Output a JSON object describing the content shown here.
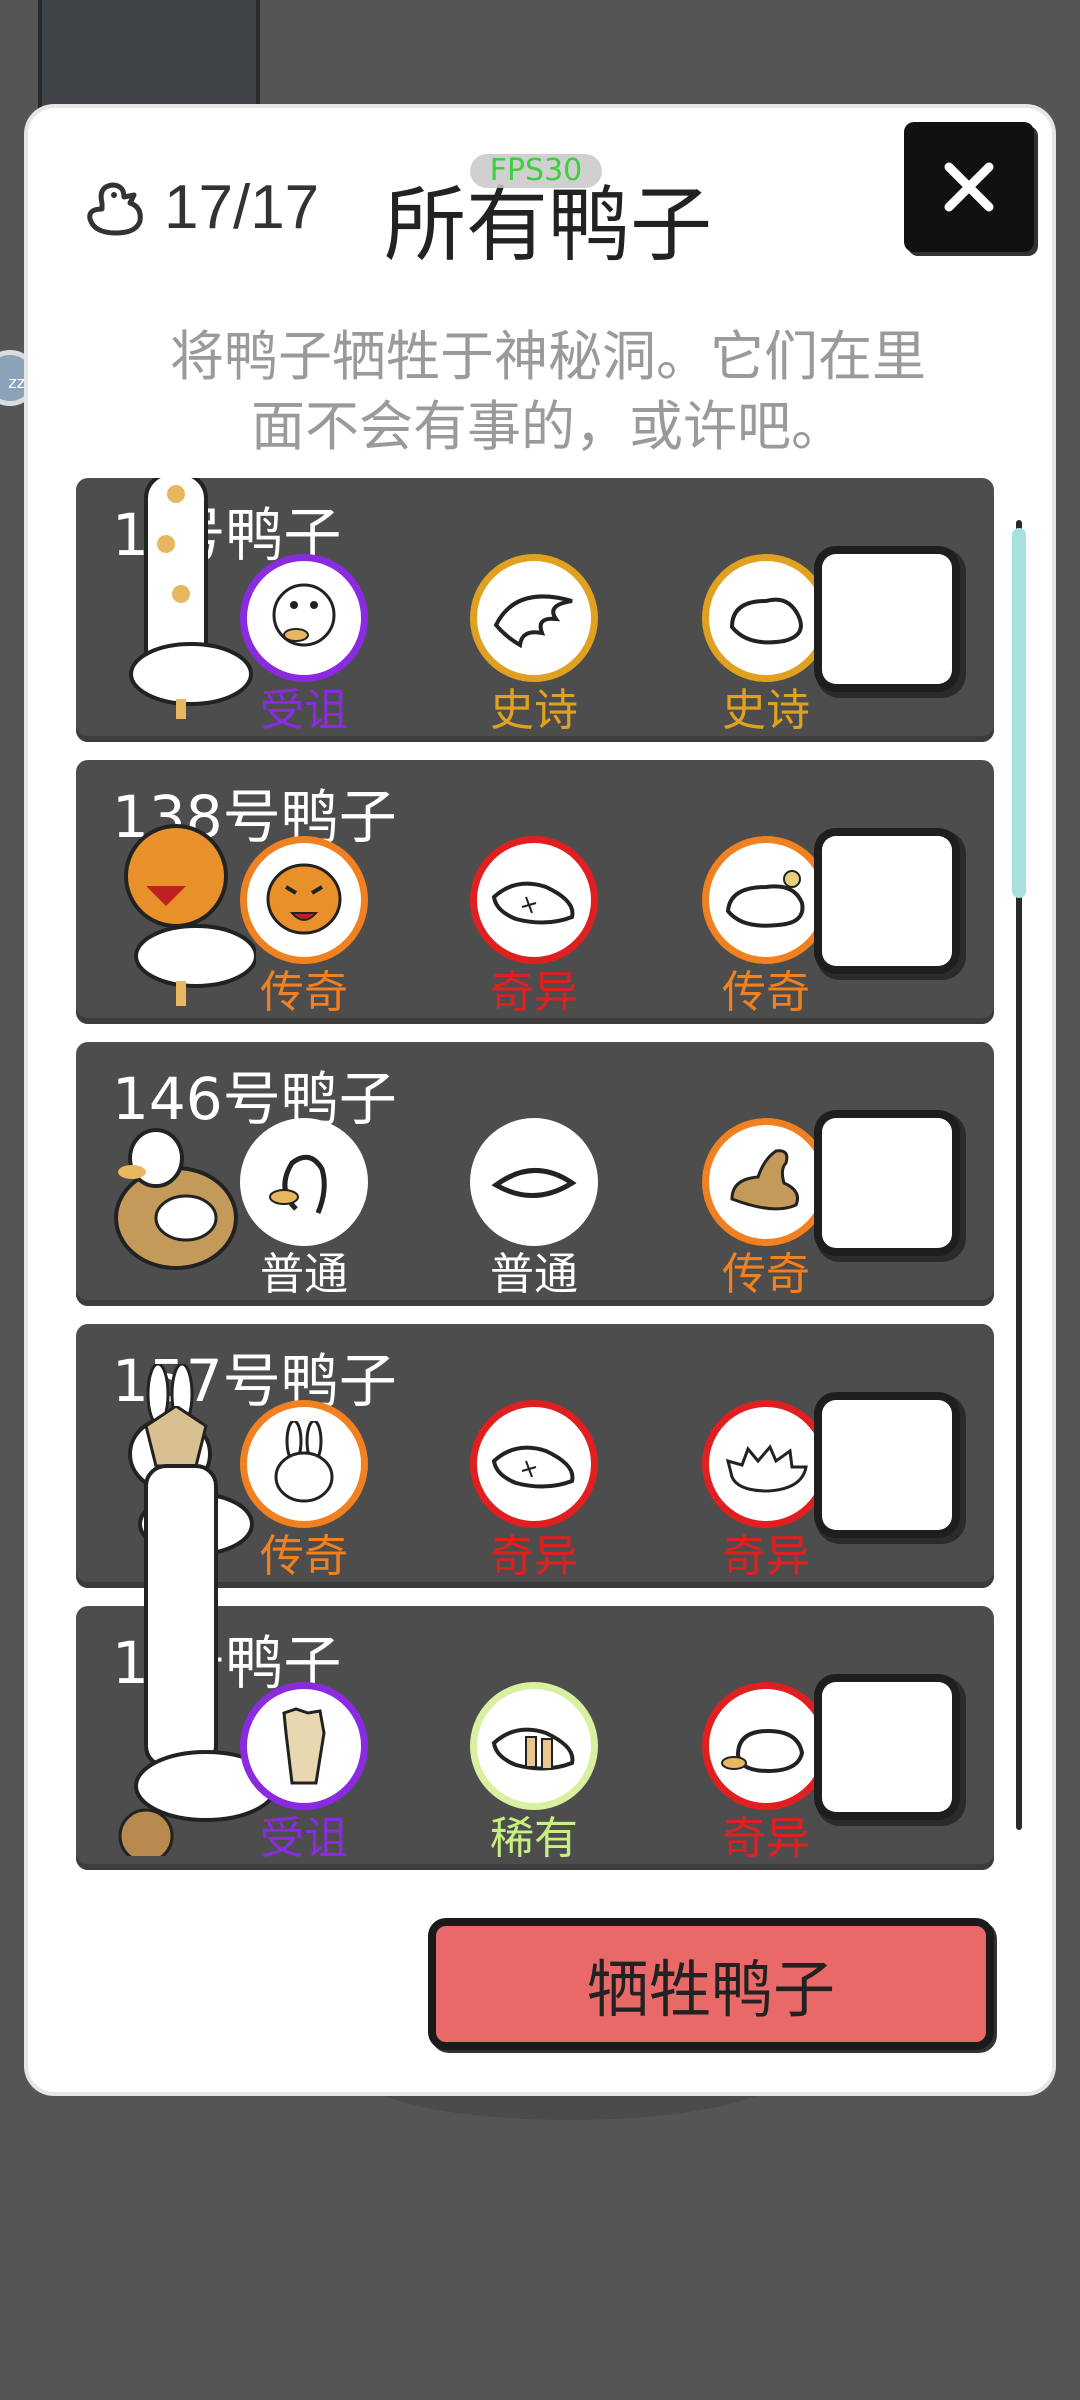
{
  "header": {
    "duck_count": "17/17",
    "title": "所有鸭子",
    "fps": "FPS30",
    "subtitle_line1": "将鸭子牺牲于神秘洞。它们在里",
    "subtitle_line2": "面不会有事的，或许吧。"
  },
  "ducks": [
    {
      "name": "1  号鸭子",
      "slots": [
        {
          "icon": "ghost-duck-head-icon",
          "rarity": "受诅",
          "color": "#8a2be2"
        },
        {
          "icon": "wing-icon",
          "rarity": "史诗",
          "color": "#e0a020"
        },
        {
          "icon": "duck-body-icon",
          "rarity": "史诗",
          "color": "#e0a020"
        }
      ]
    },
    {
      "name": "138号鸭子",
      "slots": [
        {
          "icon": "tiger-head-icon",
          "rarity": "传奇",
          "color": "#f08020"
        },
        {
          "icon": "stitched-wing-icon",
          "rarity": "奇异",
          "color": "#e02020"
        },
        {
          "icon": "duck-body-icon",
          "rarity": "传奇",
          "color": "#f08020"
        }
      ]
    },
    {
      "name": "146号鸭子",
      "slots": [
        {
          "icon": "duck-head-icon",
          "rarity": "普通",
          "color": "#ffffff"
        },
        {
          "icon": "wing-icon",
          "rarity": "普通",
          "color": "#ffffff"
        },
        {
          "icon": "brown-body-icon",
          "rarity": "传奇",
          "color": "#f08020"
        }
      ]
    },
    {
      "name": "157号鸭子",
      "slots": [
        {
          "icon": "rabbit-head-icon",
          "rarity": "传奇",
          "color": "#f08020"
        },
        {
          "icon": "stitched-wing-icon",
          "rarity": "奇异",
          "color": "#e02020"
        },
        {
          "icon": "spiky-body-icon",
          "rarity": "奇异",
          "color": "#e02020"
        }
      ]
    },
    {
      "name": "1  号鸭子",
      "slots": [
        {
          "icon": "claw-head-icon",
          "rarity": "受诅",
          "color": "#8a2be2"
        },
        {
          "icon": "bandaged-wing-icon",
          "rarity": "稀有",
          "color": "#c8f080"
        },
        {
          "icon": "duck-body-icon",
          "rarity": "奇异",
          "color": "#e02020"
        }
      ]
    }
  ],
  "sacrifice_button": "牺牲鸭子"
}
